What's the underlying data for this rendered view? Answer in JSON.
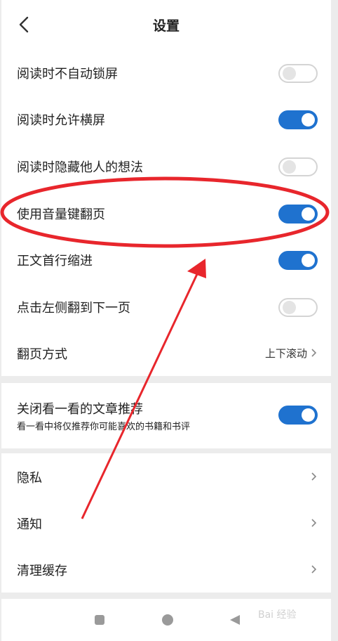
{
  "header": {
    "title": "设置",
    "back_icon": "chevron-left-icon"
  },
  "section1": {
    "rows": [
      {
        "label": "阅读时不自动锁屏",
        "toggle": "off"
      },
      {
        "label": "阅读时允许横屏",
        "toggle": "on"
      },
      {
        "label": "阅读时隐藏他人的想法",
        "toggle": "off"
      },
      {
        "label": "使用音量键翻页",
        "toggle": "on"
      },
      {
        "label": "正文首行缩进",
        "toggle": "on"
      },
      {
        "label": "点击左侧翻到下一页",
        "toggle": "off"
      },
      {
        "label": "翻页方式",
        "value": "上下滚动"
      }
    ]
  },
  "section2": {
    "label": "关闭看一看的文章推荐",
    "subtitle": "看一看中将仅推荐你可能喜欢的书籍和书评",
    "toggle": "on"
  },
  "section3": {
    "rows": [
      {
        "label": "隐私"
      },
      {
        "label": "通知"
      },
      {
        "label": "清理缓存"
      }
    ]
  },
  "navbar": {
    "icons": [
      "square-icon",
      "circle-icon",
      "back-triangle-icon"
    ]
  },
  "watermark": {
    "text": "Bai 经验"
  },
  "colors": {
    "toggle_on": "#1f72cf",
    "annotation_red": "#e8262c",
    "background": "#ececec"
  }
}
